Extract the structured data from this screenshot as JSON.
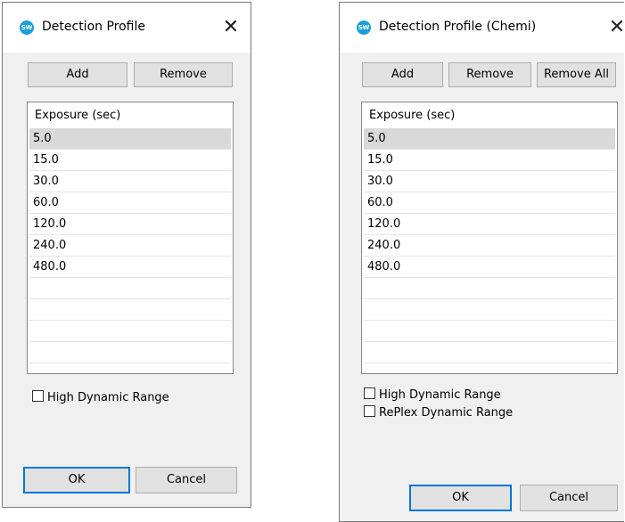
{
  "left_dialog": {
    "title": "Detection Profile",
    "icon_text": "SW",
    "close": "✕",
    "buttons": {
      "add": "Add",
      "remove": "Remove"
    },
    "list": {
      "header": "Exposure (sec)",
      "rows": [
        "5.0",
        "15.0",
        "30.0",
        "60.0",
        "120.0",
        "240.0",
        "480.0",
        "",
        "",
        "",
        ""
      ],
      "selected_index": 0
    },
    "checkboxes": [
      {
        "label": "High Dynamic Range",
        "checked": false
      }
    ],
    "footer": {
      "ok": "OK",
      "cancel": "Cancel"
    }
  },
  "right_dialog": {
    "title": "Detection Profile (Chemi)",
    "icon_text": "SW",
    "close": "✕",
    "buttons": {
      "add": "Add",
      "remove": "Remove",
      "remove_all": "Remove All"
    },
    "list": {
      "header": "Exposure (sec)",
      "rows": [
        "5.0",
        "15.0",
        "30.0",
        "60.0",
        "120.0",
        "240.0",
        "480.0",
        "",
        "",
        "",
        ""
      ],
      "selected_index": 0
    },
    "checkboxes": [
      {
        "label": "High Dynamic Range",
        "checked": false
      },
      {
        "label": "RePlex Dynamic Range",
        "checked": false
      }
    ],
    "footer": {
      "ok": "OK",
      "cancel": "Cancel"
    }
  },
  "colors": {
    "dialog_bg": "#f0f0f0",
    "button_bg": "#e1e1e1",
    "default_button_border": "#0078d7",
    "selected_row": "#d9d9d9",
    "app_icon": "#1a9fd8"
  }
}
